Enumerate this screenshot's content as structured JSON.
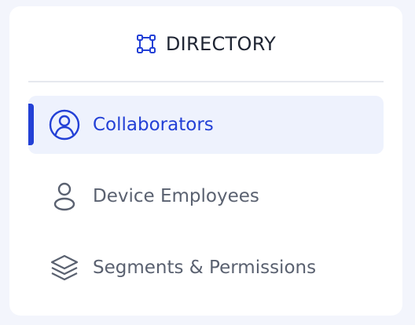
{
  "header": {
    "title": "DIRECTORY",
    "icon": "directory-nodes-icon"
  },
  "nav": {
    "items": [
      {
        "label": "Collaborators",
        "icon": "user-circle-icon",
        "active": true
      },
      {
        "label": "Device Employees",
        "icon": "user-icon",
        "active": false
      },
      {
        "label": "Segments & Permissions",
        "icon": "layers-icon",
        "active": false
      }
    ]
  },
  "colors": {
    "accent": "#2340d6",
    "active_background": "#eef2fd",
    "text_muted": "#5a6170",
    "title_text": "#1f2533"
  }
}
